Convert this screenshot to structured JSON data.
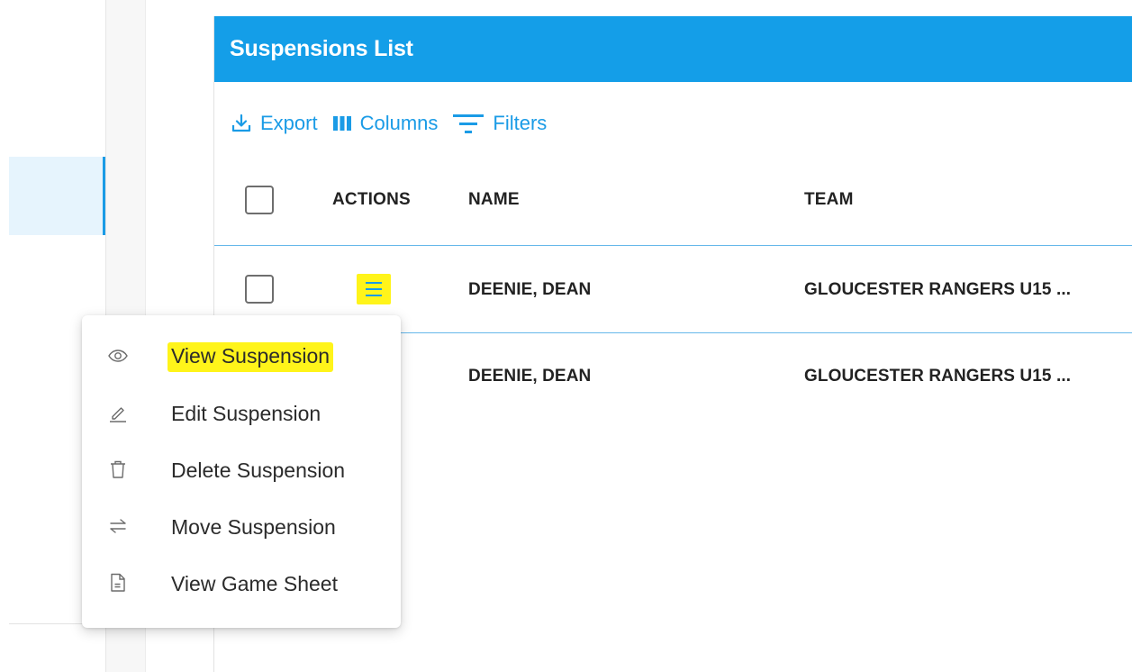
{
  "panel": {
    "title": "Suspensions List",
    "header_color": "#149ee8"
  },
  "toolbar": {
    "export_label": "Export",
    "columns_label": "Columns",
    "filters_label": "Filters"
  },
  "table": {
    "columns": [
      "ACTIONS",
      "NAME",
      "TEAM"
    ],
    "rows": [
      {
        "name": "DEENIE, DEAN",
        "team": "GLOUCESTER RANGERS U15 ..."
      },
      {
        "name": "DEENIE, DEAN",
        "team": "GLOUCESTER RANGERS U15 ..."
      }
    ]
  },
  "menu": {
    "items": [
      {
        "label": "View Suspension",
        "icon": "eye-icon",
        "highlighted": true
      },
      {
        "label": "Edit Suspension",
        "icon": "pencil-icon"
      },
      {
        "label": "Delete Suspension",
        "icon": "trash-icon"
      },
      {
        "label": "Move Suspension",
        "icon": "swap-arrows-icon"
      },
      {
        "label": "View Game Sheet",
        "icon": "document-icon"
      }
    ]
  },
  "colors": {
    "accent": "#1a9be6",
    "highlight": "#fff41a"
  }
}
